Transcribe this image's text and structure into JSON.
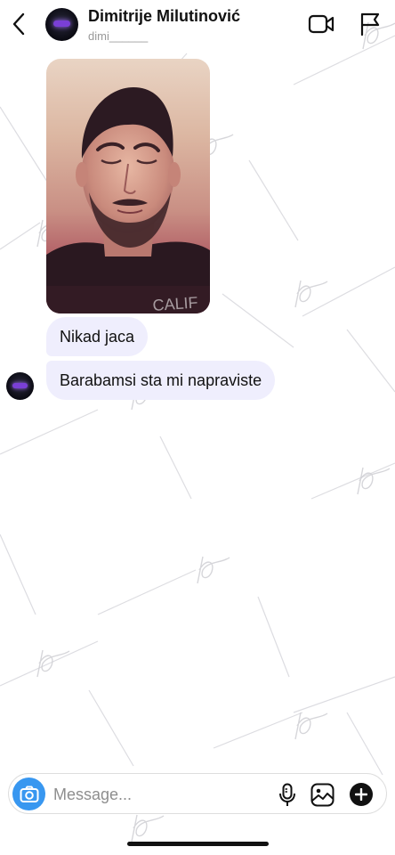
{
  "header": {
    "name": "Dimitrije Milutinović",
    "username": "dimi______",
    "icons": {
      "back": "chevron-left-icon",
      "video": "video-camera-icon",
      "flag": "flag-icon"
    }
  },
  "messages": [
    {
      "type": "photo",
      "description_icon": "photo-message"
    },
    {
      "type": "text",
      "text": "Nikad jaca"
    },
    {
      "type": "text",
      "text": "Barabamsi sta mi napraviste"
    }
  ],
  "composer": {
    "placeholder": "Message...",
    "icons": {
      "camera": "camera-icon",
      "mic": "microphone-icon",
      "gallery": "image-icon",
      "plus": "plus-icon"
    }
  },
  "colors": {
    "bubble": "#efeefd",
    "camera_button": "#3897f0",
    "watermark": "#cfcfd4"
  }
}
